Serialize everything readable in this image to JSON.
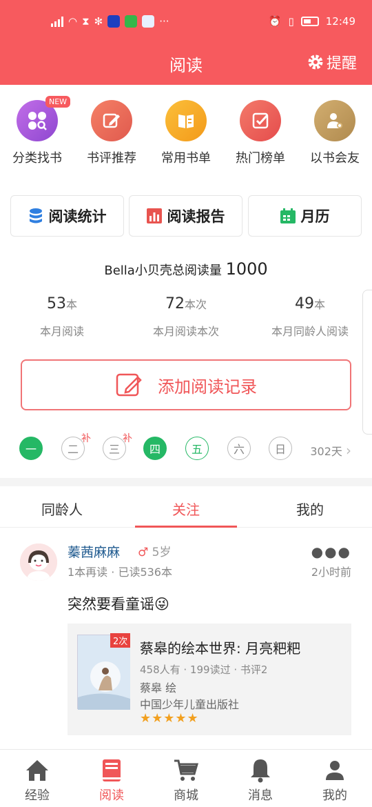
{
  "status": {
    "time": "12:49",
    "more": "···"
  },
  "header": {
    "title": "阅读",
    "remind": "提醒"
  },
  "quick": [
    {
      "label": "分类找书",
      "color": "#a65ad8",
      "badge": "NEW"
    },
    {
      "label": "书评推荐",
      "color": "#ec6c5a"
    },
    {
      "label": "常用书单",
      "color": "#f5a623"
    },
    {
      "label": "热门榜单",
      "color": "#ea5b5b"
    },
    {
      "label": "以书会友",
      "color": "#c19a5b"
    }
  ],
  "tools": {
    "stats": "阅读统计",
    "report": "阅读报告",
    "calendar": "月历"
  },
  "summary": {
    "text": "Bella小贝壳总阅读量",
    "total": "1000"
  },
  "stats": [
    {
      "num": "53",
      "unit": "本",
      "label": "本月阅读"
    },
    {
      "num": "72",
      "unit": "本次",
      "label": "本月阅读本次"
    },
    {
      "num": "49",
      "unit": "本",
      "label": "本月同龄人阅读"
    }
  ],
  "add_record": "添加阅读记录",
  "week": {
    "days": [
      "一",
      "二",
      "三",
      "四",
      "五",
      "六",
      "日"
    ],
    "makeup": "补",
    "count": "302天"
  },
  "tabs": [
    "同龄人",
    "关注",
    "我的"
  ],
  "post": {
    "user": "蓁茜麻麻",
    "gender": "♂",
    "age": "5岁",
    "meta": "1本再读 · 已读536本",
    "ago": "2小时前",
    "content": "突然要看童谣😜",
    "book": {
      "count": "2次",
      "title": "蔡皋的绘本世界: 月亮粑粑",
      "info": "458人有 · 199读过 · 书评2",
      "author": "蔡皋 绘",
      "publisher": "中国少年儿童出版社",
      "stars": "★★★★★"
    }
  },
  "nav": [
    {
      "label": "经验"
    },
    {
      "label": "阅读"
    },
    {
      "label": "商城"
    },
    {
      "label": "消息"
    },
    {
      "label": "我的"
    }
  ]
}
